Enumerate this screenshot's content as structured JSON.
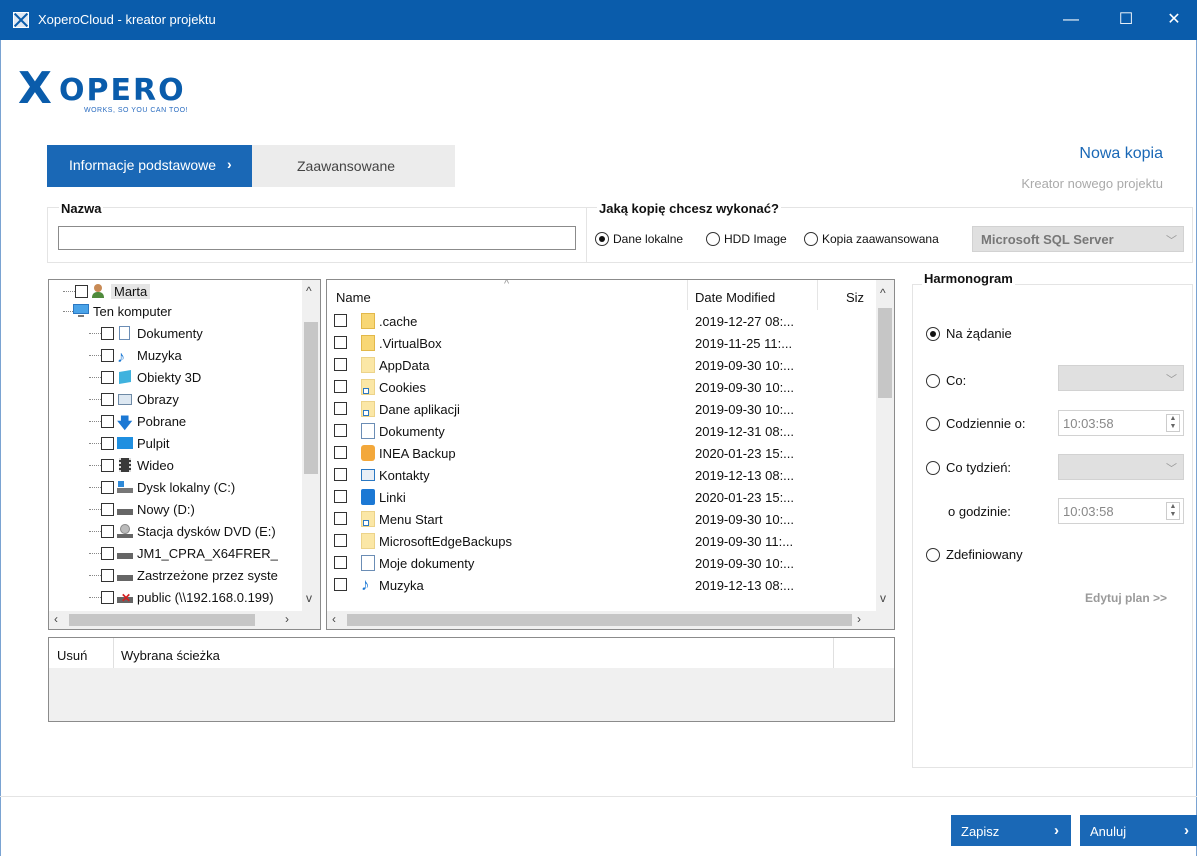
{
  "window": {
    "title": "XoperoCloud - kreator projektu",
    "minimize": "—",
    "maximize": "☐",
    "close": "✕"
  },
  "logo": {
    "mark": "X",
    "word": "OPERO",
    "tagline": "WORKS, SO YOU CAN TOO!"
  },
  "tabs": {
    "active": "Informacje podstawowe",
    "active_chevron": "›",
    "other": "Zaawansowane"
  },
  "header": {
    "title": "Nowa kopia",
    "subtitle": "Kreator nowego projektu"
  },
  "name_section": {
    "label": "Nazwa",
    "value": ""
  },
  "backup_type": {
    "label": "Jaką kopię chcesz wykonać?",
    "options": [
      "Dane lokalne",
      "HDD Image",
      "Kopia zaawansowana"
    ],
    "selected": "Dane lokalne",
    "select_value": "Microsoft SQL Server"
  },
  "tree": {
    "items": [
      {
        "label": "Marta",
        "icon": "user-icon"
      },
      {
        "label": "Ten komputer",
        "icon": "computer-icon"
      },
      {
        "label": "Dokumenty",
        "icon": "document-icon"
      },
      {
        "label": "Muzyka",
        "icon": "music-icon"
      },
      {
        "label": "Obiekty 3D",
        "icon": "cube-icon"
      },
      {
        "label": "Obrazy",
        "icon": "picture-icon"
      },
      {
        "label": "Pobrane",
        "icon": "download-icon"
      },
      {
        "label": "Pulpit",
        "icon": "desktop-icon"
      },
      {
        "label": "Wideo",
        "icon": "video-icon"
      },
      {
        "label": "Dysk lokalny (C:)",
        "icon": "drive-icon"
      },
      {
        "label": "Nowy (D:)",
        "icon": "drive-icon"
      },
      {
        "label": "Stacja dysków DVD (E:)",
        "icon": "dvd-icon"
      },
      {
        "label": "JM1_CPRA_X64FRER_",
        "icon": "drive-icon"
      },
      {
        "label": "Zastrzeżone przez syste",
        "icon": "drive-icon"
      },
      {
        "label": "public (\\\\192.168.0.199)",
        "icon": "network-drive-icon"
      }
    ]
  },
  "files": {
    "columns": {
      "name": "Name",
      "date": "Date Modified",
      "size": "Siz"
    },
    "rows": [
      {
        "name": ".cache",
        "date": "2019-12-27 08:...",
        "icon": "folder-icon"
      },
      {
        "name": ".VirtualBox",
        "date": "2019-11-25 11:...",
        "icon": "folder-icon"
      },
      {
        "name": "AppData",
        "date": "2019-09-30 10:...",
        "icon": "folder-icon"
      },
      {
        "name": "Cookies",
        "date": "2019-09-30 10:...",
        "icon": "folder-shortcut-icon"
      },
      {
        "name": "Dane aplikacji",
        "date": "2019-09-30 10:...",
        "icon": "folder-shortcut-icon"
      },
      {
        "name": "Dokumenty",
        "date": "2019-12-31 08:...",
        "icon": "document-icon"
      },
      {
        "name": "INEA Backup",
        "date": "2020-01-23 15:...",
        "icon": "backup-icon"
      },
      {
        "name": "Kontakty",
        "date": "2019-12-13 08:...",
        "icon": "contacts-icon"
      },
      {
        "name": "Linki",
        "date": "2020-01-23 15:...",
        "icon": "links-icon"
      },
      {
        "name": "Menu Start",
        "date": "2019-09-30 10:...",
        "icon": "folder-shortcut-icon"
      },
      {
        "name": "MicrosoftEdgeBackups",
        "date": "2019-09-30 11:...",
        "icon": "folder-icon"
      },
      {
        "name": "Moje dokumenty",
        "date": "2019-09-30 10:...",
        "icon": "document-shortcut-icon"
      },
      {
        "name": "Muzyka",
        "date": "2019-12-13 08:...",
        "icon": "music-icon"
      }
    ]
  },
  "selected_paths": {
    "col_remove": "Usuń",
    "col_path": "Wybrana ścieżka"
  },
  "schedule": {
    "label": "Harmonogram",
    "on_demand": "Na żądanie",
    "every": "Co:",
    "daily": "Codziennie o:",
    "daily_time": "10:03:58",
    "weekly": "Co tydzień:",
    "at_hour": "o godzinie:",
    "weekly_time": "10:03:58",
    "defined": "Zdefiniowany",
    "edit_plan": "Edytuj plan >>",
    "selected": "Na żądanie"
  },
  "footer": {
    "save": "Zapisz",
    "cancel": "Anuluj",
    "chevron": "›"
  },
  "colors": {
    "titlebar": "#0a5cab",
    "accent": "#1a68b6"
  }
}
